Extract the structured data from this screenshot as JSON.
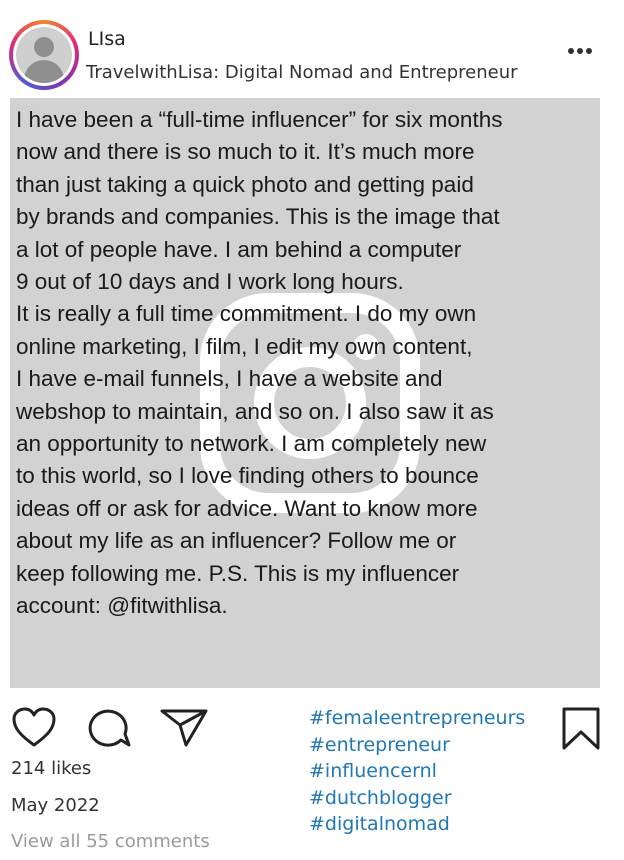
{
  "header": {
    "username": "LIsa",
    "subtitle": "TravelwithLisa: Digital Nomad and Entrepreneur"
  },
  "post": {
    "text": "I have been a “full-time influencer” for six months\nnow and there is so much to it. It’s much more\nthan just taking a quick photo and getting paid\nby brands and companies. This is the image that\na lot of people have. I am behind a computer\n9 out of 10 days and I work long hours.\nIt is really a full time commitment. I do my own\nonline marketing, I film, I edit my own content,\nI have e-mail funnels, I have a website and\nwebshop to maintain, and so on. I also saw it as\nan opportunity to network. I am completely new\nto this world, so I love finding others to bounce\nideas off or ask for advice. Want to know more\nabout my life as an influencer? Follow me or\nkeep following me. P.S. This is my influencer\naccount: @fitwithlisa."
  },
  "footer": {
    "likes": "214 likes",
    "date": "May 2022",
    "comments": "View all 55 comments"
  },
  "hashtags": [
    "#femaleentrepreneurs",
    "#entrepreneur",
    "#influencernl",
    "#dutchblogger",
    "#digitalnomad"
  ],
  "icons": {
    "like": "heart-icon",
    "comment": "comment-icon",
    "share": "share-icon",
    "save": "bookmark-icon",
    "more": "more-icon",
    "watermark": "instagram-logo-icon"
  },
  "colors": {
    "post_background": "#d2d2d2",
    "hashtag": "#1f77b4",
    "muted_text": "#9a9a9a"
  }
}
